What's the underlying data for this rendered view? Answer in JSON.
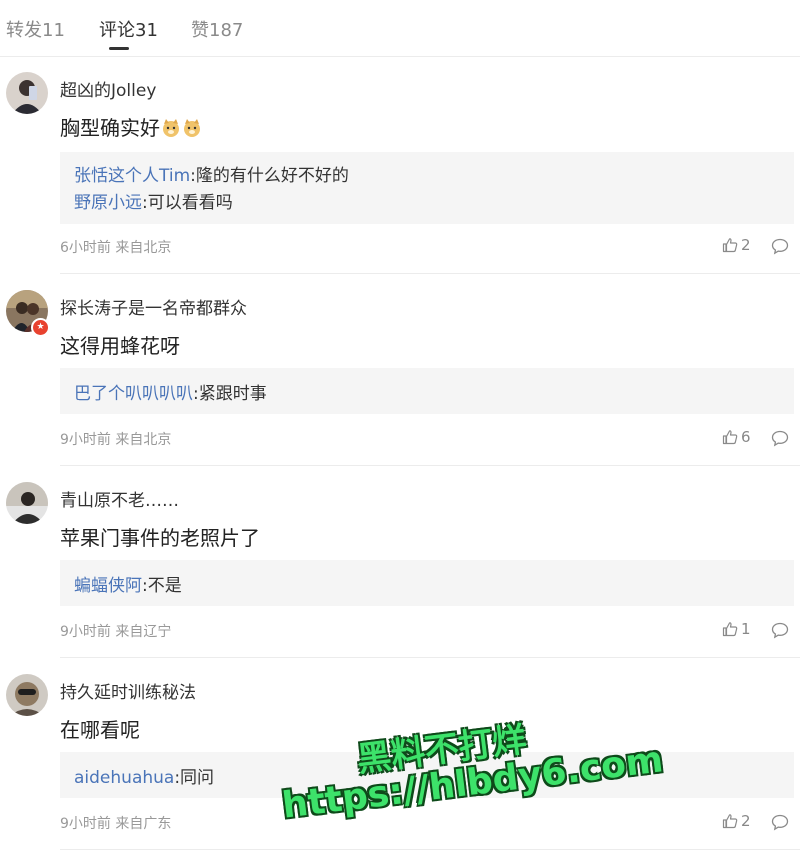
{
  "tabs": [
    {
      "label": "转发11",
      "active": false
    },
    {
      "label": "评论31",
      "active": true
    },
    {
      "label": "赞187",
      "active": false
    }
  ],
  "comments": [
    {
      "username": "超凶的Jolley",
      "text": "胸型确实好",
      "emoji": [
        "doge-icon",
        "doge-icon"
      ],
      "replies": [
        {
          "name": "张恬这个人Tim",
          "text": ":隆的有什么好不好的"
        },
        {
          "name": "野原小远",
          "text": ":可以看看吗"
        }
      ],
      "meta": "6小时前 来自北京",
      "likes": "2"
    },
    {
      "username": "探长涛子是一名帝都群众",
      "text": "这得用蜂花呀",
      "verified": true,
      "replies": [
        {
          "name": "巴了个叭叭叭叭",
          "text": ":紧跟时事"
        }
      ],
      "meta": "9小时前 来自北京",
      "likes": "6"
    },
    {
      "username": "青山原不老……",
      "text": "苹果门事件的老照片了",
      "replies": [
        {
          "name": "蝙蝠侠阿",
          "text": ":不是"
        }
      ],
      "meta": "9小时前 来自辽宁",
      "likes": "1"
    },
    {
      "username": "持久延时训练秘法",
      "text": "在哪看呢",
      "replies": [
        {
          "name": "aidehuahua",
          "text": ":同问"
        }
      ],
      "meta": "9小时前 来自广东",
      "likes": "2"
    }
  ],
  "watermark": {
    "line1": "黑料不打烊",
    "line2": "https://hlbdy6.com"
  },
  "colors": {
    "reply_name": "#4a74b8",
    "watermark_fill": "#3de26a",
    "verified_badge": "#e8422f"
  }
}
